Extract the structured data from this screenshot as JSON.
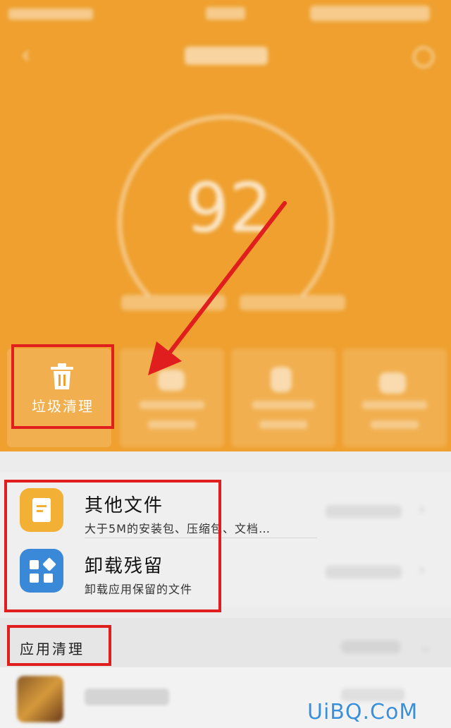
{
  "header": {
    "score": "92",
    "junk_clean_label": "垃圾清理"
  },
  "list": {
    "items": [
      {
        "title": "其他文件",
        "subtitle": "大于5M的安装包、压缩包、文档…",
        "icon": "document-icon"
      },
      {
        "title": "卸载残留",
        "subtitle": "卸载应用保留的文件",
        "icon": "apps-grid-icon"
      }
    ]
  },
  "section": {
    "label": "应用清理"
  },
  "watermark": "UiBQ.CoM",
  "colors": {
    "header_bg": "#efa02e",
    "highlight": "#e01e1e",
    "doc_icon_bg": "#f2b035",
    "apps_icon_bg": "#3a88d8"
  }
}
